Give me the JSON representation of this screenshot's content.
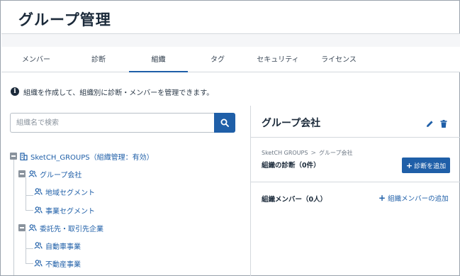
{
  "header": {
    "title": "グループ管理"
  },
  "tabs": [
    {
      "label": "メンバー",
      "active": false
    },
    {
      "label": "診断",
      "active": false
    },
    {
      "label": "組織",
      "active": true
    },
    {
      "label": "タグ",
      "active": false
    },
    {
      "label": "セキュリティ",
      "active": false
    },
    {
      "label": "ライセンス",
      "active": false
    }
  ],
  "info": {
    "icon": "info-icon",
    "text": "組織を作成して、組織別に診断・メンバーを管理できます。"
  },
  "search": {
    "placeholder": "組織名で検索",
    "value": "",
    "button_icon": "search-icon"
  },
  "tree": {
    "root": {
      "label": "SketCH_GROUPS（組織管理：有効）",
      "icon": "building-icon"
    },
    "groups": [
      {
        "label": "グループ会社",
        "icon": "users-icon",
        "children": [
          {
            "label": "地域セグメント",
            "icon": "users-icon"
          },
          {
            "label": "事業セグメント",
            "icon": "users-icon"
          }
        ]
      },
      {
        "label": "委託先・取引先企業",
        "icon": "users-icon",
        "children": [
          {
            "label": "自動車事業",
            "icon": "users-icon"
          },
          {
            "label": "不動産事業",
            "icon": "users-icon"
          }
        ]
      }
    ]
  },
  "detail": {
    "title": "グループ会社",
    "breadcrumb": [
      "SketCH GROUPS",
      "グループ会社"
    ],
    "diagnosis_label": "組織の診断（0件）",
    "add_diagnosis_label": "診断を追加",
    "members_label": "組織メンバー（0人）",
    "add_member_label": "組織メンバーの追加"
  },
  "colors": {
    "accent": "#1f5fa8",
    "text": "#1b2a3a",
    "border": "#d4d8dd",
    "icon_gray": "#8a939d"
  }
}
